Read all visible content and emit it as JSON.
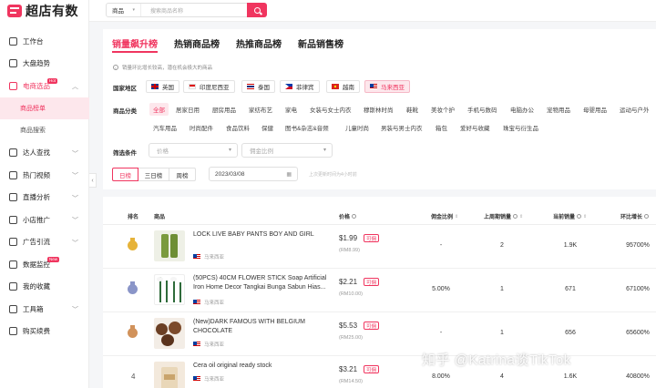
{
  "app": {
    "logo_text": "超店有数"
  },
  "sidebar": {
    "items": [
      {
        "label": "工作台",
        "icon": "workbench-icon",
        "expand": false
      },
      {
        "label": "大盘趋势",
        "icon": "trend-icon",
        "expand": false
      },
      {
        "label": "电商选品",
        "icon": "ecommerce-icon",
        "expand": true,
        "badge": "Hot",
        "active": true
      },
      {
        "label": "达人查找",
        "icon": "influencer-icon",
        "expand": true
      },
      {
        "label": "热门视频",
        "icon": "video-icon",
        "expand": true
      },
      {
        "label": "直播分析",
        "icon": "live-icon",
        "expand": true
      },
      {
        "label": "小店推广",
        "icon": "shop-icon",
        "expand": true
      },
      {
        "label": "广告引流",
        "icon": "ad-icon",
        "expand": true
      },
      {
        "label": "数据监控",
        "icon": "monitor-icon",
        "expand": false,
        "badge": "New"
      },
      {
        "label": "我的收藏",
        "icon": "favorite-icon",
        "expand": false
      },
      {
        "label": "工具箱",
        "icon": "toolbox-icon",
        "expand": true
      },
      {
        "label": "购买续费",
        "icon": "purchase-icon",
        "expand": false
      }
    ],
    "sub_items": [
      "商品榜单",
      "商品搜索"
    ]
  },
  "search": {
    "category": "商品",
    "placeholder": "搜索商品名称"
  },
  "tabs": [
    "销量飙升榜",
    "热销商品榜",
    "热推商品榜",
    "新品销售榜"
  ],
  "note": "销量环比增长较高，潜在机会极大的商品",
  "filters": {
    "country_label": "国家地区",
    "countries": [
      "英国",
      "印度尼西亚",
      "泰国",
      "菲律宾",
      "越南",
      "马来西亚"
    ],
    "category_label": "商品分类",
    "categories_row1": [
      "全部",
      "居家日用",
      "厨房用品",
      "家纺布艺",
      "家电",
      "女装与女士内衣",
      "穆斯林时尚",
      "鞋靴",
      "美妆个护",
      "手机与数码",
      "电脑办公",
      "宠物用品",
      "母婴用品",
      "运动与户外"
    ],
    "categories_row2": [
      "汽车用品",
      "时尚配件",
      "食品饮料",
      "保健",
      "图书&杂志&音频",
      "儿童时尚",
      "男装与男士内衣",
      "箱包",
      "爱好与收藏",
      "珠宝与衍生品"
    ],
    "condition_label": "筛选条件",
    "price_placeholder": "价格",
    "commission_placeholder": "佣金比例",
    "period_buttons": [
      "日榜",
      "三日榜",
      "周榜"
    ],
    "date": "2023/03/08",
    "update_note": "上次更新时间为4小时前"
  },
  "table": {
    "headers": [
      "排名",
      "商品",
      "价格",
      "佣金比例",
      "上周期销量",
      "当前销量",
      "环比增长"
    ],
    "fold_tag": "可佣",
    "rows": [
      {
        "rank": "1",
        "name": "LOCK LIVE BABY PANTS BOY AND GIRL",
        "region": "马来西亚",
        "price": "$1.99",
        "price_rm": "(RM8.99)",
        "commission": "-",
        "prev_sales": "2",
        "cur_sales": "1.9K",
        "growth": "95700%"
      },
      {
        "rank": "2",
        "name": "(50PCS) 40CM FLOWER STICK Soap Artificial Iron Home Decor Tangkai Bunga Sabun Hias...",
        "region": "马来西亚",
        "price": "$2.21",
        "price_rm": "(RM10.00)",
        "commission": "5.00%",
        "prev_sales": "1",
        "cur_sales": "671",
        "growth": "67100%"
      },
      {
        "rank": "3",
        "name": "(New)DARK FAMOUS WITH BELGIUM CHOCOLATE",
        "region": "马来西亚",
        "price": "$5.53",
        "price_rm": "(RM25.00)",
        "commission": "-",
        "prev_sales": "1",
        "cur_sales": "656",
        "growth": "65600%"
      },
      {
        "rank": "4",
        "name": "Cera oil original ready stock",
        "region": "马来西亚",
        "price": "$3.21",
        "price_rm": "(RM14.50)",
        "commission": "8.00%",
        "prev_sales": "4",
        "cur_sales": "1.6K",
        "growth": "40800%"
      }
    ]
  },
  "watermark": "知乎 @Katrina谈TikTok",
  "colors": {
    "accent": "#f0355f",
    "accent_light": "#fde7ec",
    "gold": "#e6b33a",
    "silver": "#8a95c8",
    "bronze": "#d1925b"
  }
}
